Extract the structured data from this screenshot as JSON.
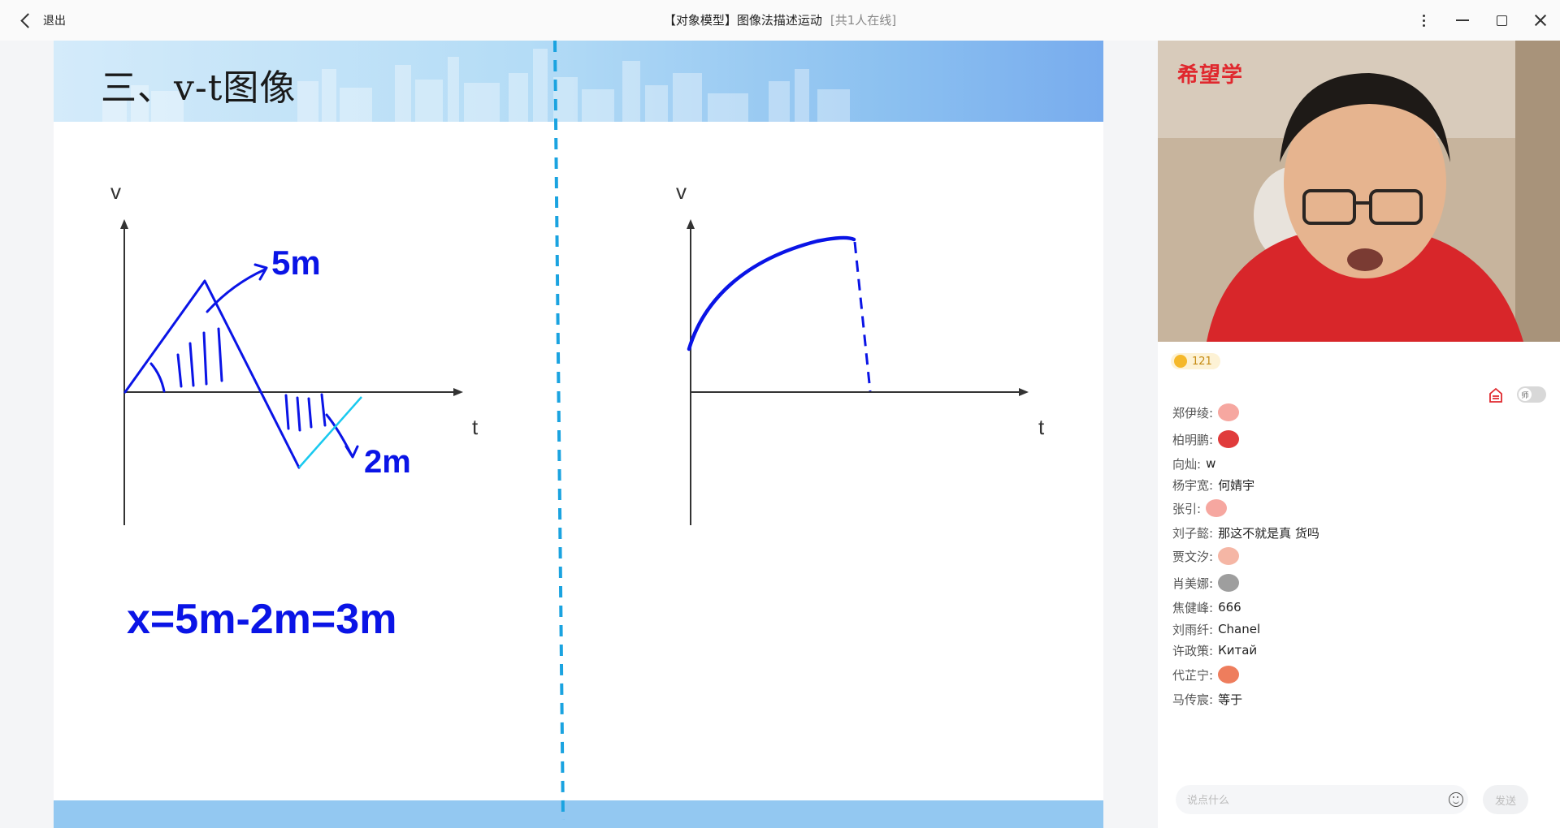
{
  "titlebar": {
    "exit_label": "退出",
    "title": "【对象模型】图像法描述运动",
    "online": "[共1人在线]"
  },
  "slide": {
    "title": "三、v-t图像",
    "left_graph": {
      "v_label": "v",
      "t_label": "t",
      "annot_top": "5m",
      "annot_bottom": "2m"
    },
    "right_graph": {
      "v_label": "v",
      "t_label": "t"
    },
    "equation": "x=5m-2m=3m"
  },
  "video": {
    "brand": "希望学"
  },
  "panel": {
    "coin_count": "121",
    "toggle_label": "师",
    "chat": [
      {
        "name": "郑伊绫:",
        "text": "",
        "emoji": "thumbs-up"
      },
      {
        "name": "柏明鹏:",
        "text": "",
        "emoji": "kiss-lips"
      },
      {
        "name": "向灿:",
        "text": "w",
        "emoji": ""
      },
      {
        "name": "杨宇宽:",
        "text": "何婧宇",
        "emoji": ""
      },
      {
        "name": "张引:",
        "text": "",
        "emoji": "thumbs-up"
      },
      {
        "name": "刘子懿:",
        "text": "那这不就是真 货吗",
        "emoji": ""
      },
      {
        "name": "贾文汐:",
        "text": "",
        "emoji": "ok-hand"
      },
      {
        "name": "肖美娜:",
        "text": "",
        "emoji": "monkey"
      },
      {
        "name": "焦健峰:",
        "text": "666",
        "emoji": ""
      },
      {
        "name": "刘雨纤:",
        "text": "Chanel",
        "emoji": ""
      },
      {
        "name": "许政策:",
        "text": "Китай",
        "emoji": ""
      },
      {
        "name": "代芷宁:",
        "text": "",
        "emoji": "monkey-face"
      },
      {
        "name": "马传宸:",
        "text": "等于",
        "emoji": ""
      }
    ],
    "input_placeholder": "说点什么",
    "send_label": "发送"
  },
  "colors": {
    "ink": "#0a14e6",
    "dash": "#1aa3e0",
    "accent": "#e0282e"
  }
}
